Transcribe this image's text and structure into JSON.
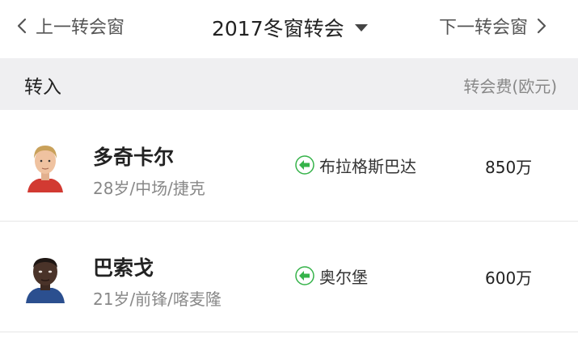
{
  "nav": {
    "prev_label": "上一转会窗",
    "next_label": "下一转会窗",
    "title": "2017冬窗转会",
    "icons": {
      "prev": "chevron-left-icon",
      "next": "chevron-right-icon",
      "dropdown": "caret-down-icon"
    }
  },
  "section": {
    "title": "转入",
    "fee_header": "转会费(欧元)"
  },
  "transfers": [
    {
      "name": "多奇卡尔",
      "info": "28岁/中场/捷克",
      "from_club": "布拉格斯巴达",
      "fee": "850万"
    },
    {
      "name": "巴索戈",
      "info": "21岁/前锋/喀麦隆",
      "from_club": "奥尔堡",
      "fee": "600万"
    }
  ],
  "colors": {
    "arrow_green": "#36b34a",
    "header_bg": "#efeff1",
    "muted_text": "#888888"
  }
}
